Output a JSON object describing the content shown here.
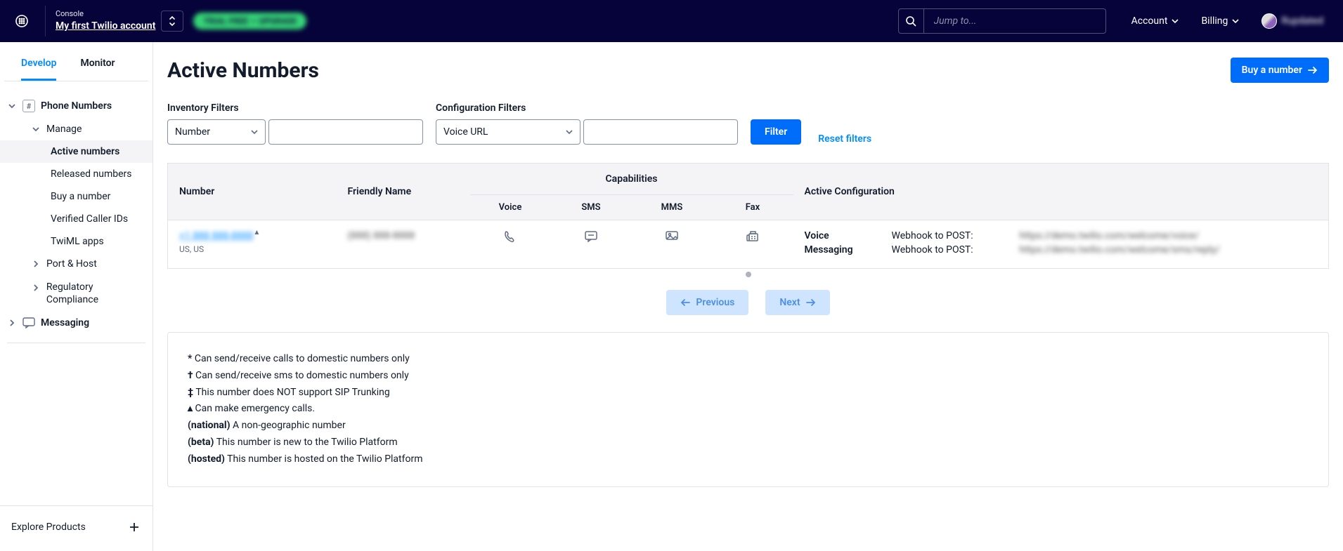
{
  "topnav": {
    "console_label": "Console",
    "account_link": "My first Twilio account",
    "trial_text": "TRIAL FREE — UPGRADE",
    "search_placeholder": "Jump to...",
    "link_account": "Account",
    "link_billing": "Billing",
    "username": "Rupdated"
  },
  "sidebar": {
    "tab_develop": "Develop",
    "tab_monitor": "Monitor",
    "phone_numbers": "Phone Numbers",
    "manage": "Manage",
    "active_numbers": "Active numbers",
    "released": "Released numbers",
    "buy": "Buy a number",
    "verified": "Verified Caller IDs",
    "twiml": "TwiML apps",
    "port": "Port & Host",
    "regulatory": "Regulatory Compliance",
    "messaging": "Messaging",
    "explore": "Explore Products"
  },
  "main": {
    "title": "Active Numbers",
    "buy_btn": "Buy a number",
    "filters": {
      "inv_label": "Inventory Filters",
      "inv_select": "Number",
      "cfg_label": "Configuration Filters",
      "cfg_select": "Voice URL",
      "filter_btn": "Filter",
      "reset": "Reset filters"
    },
    "table": {
      "col_number": "Number",
      "col_friendly": "Friendly Name",
      "col_capabilities": "Capabilities",
      "col_active_cfg": "Active Configuration",
      "cap_voice": "Voice",
      "cap_sms": "SMS",
      "cap_mms": "MMS",
      "cap_fax": "Fax",
      "row_number_text": "+1 888 888-8888",
      "row_number_sub": "US, US",
      "row_friendly": "(888) 888-8888",
      "cfg_voice_lbl": "Voice",
      "cfg_msg_lbl": "Messaging",
      "cfg_webhook": "Webhook to POST:",
      "cfg_url1": "https://demo.twilio.com/welcome/voice/",
      "cfg_url2": "https://demo.twilio.com/welcome/sms/reply/"
    },
    "pager": {
      "prev": "Previous",
      "next": "Next"
    },
    "legend": {
      "l1_sym": "*",
      "l1_txt": "Can send/receive calls to domestic numbers only",
      "l2_sym": "†",
      "l2_txt": "Can send/receive sms to domestic numbers only",
      "l3_sym": "‡",
      "l3_txt": "This number does NOT support SIP Trunking",
      "l4_sym": "▴",
      "l4_txt": "Can make emergency calls.",
      "l5_sym": "(national)",
      "l5_txt": "A non-geographic number",
      "l6_sym": "(beta)",
      "l6_txt": "This number is new to the Twilio Platform",
      "l7_sym": "(hosted)",
      "l7_txt": "This number is hosted on the Twilio Platform"
    }
  }
}
